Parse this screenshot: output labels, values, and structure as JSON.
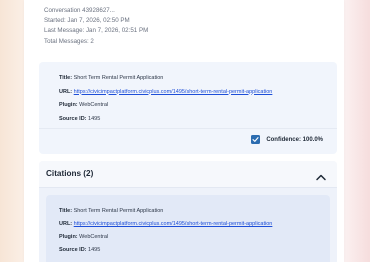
{
  "conversation": {
    "id_line": "Conversation 43928627...",
    "started": "Started: Jan 7, 2026, 02:50 PM",
    "last_message": "Last Message: Jan 7, 2026, 02:51 PM",
    "total_messages": "Total Messages: 2"
  },
  "source": {
    "title_label": "Title:",
    "title_value": " Short Term Rental Permit Application",
    "url_label": "URL:",
    "url_value": "https://civicimpactplatform.civicplus.com/1495/short-term-rental-permit-application",
    "plugin_label": "Plugin:",
    "plugin_value": " WebCentral",
    "source_id_label": "Source ID:",
    "source_id_value": " 1495",
    "confidence": "Confidence: 100.0%"
  },
  "citations": {
    "header": "Citations (2)",
    "items": [
      {
        "title_label": "Title:",
        "title_value": " Short Term Rental Permit Application",
        "url_label": "URL:",
        "url_value": "https://civicimpactplatform.civicplus.com/1495/short-term-rental-permit-application",
        "plugin_label": "Plugin:",
        "plugin_value": " WebCentral",
        "source_id_label": "Source ID:",
        "source_id_value": " 1495"
      }
    ]
  },
  "colors": {
    "accent": "#2b6cb0",
    "link": "#1d4ed8",
    "panel": "#f1f5fc"
  },
  "icons": {
    "confidence": "checkbox-checked-icon",
    "collapse": "chevron-up-icon"
  }
}
